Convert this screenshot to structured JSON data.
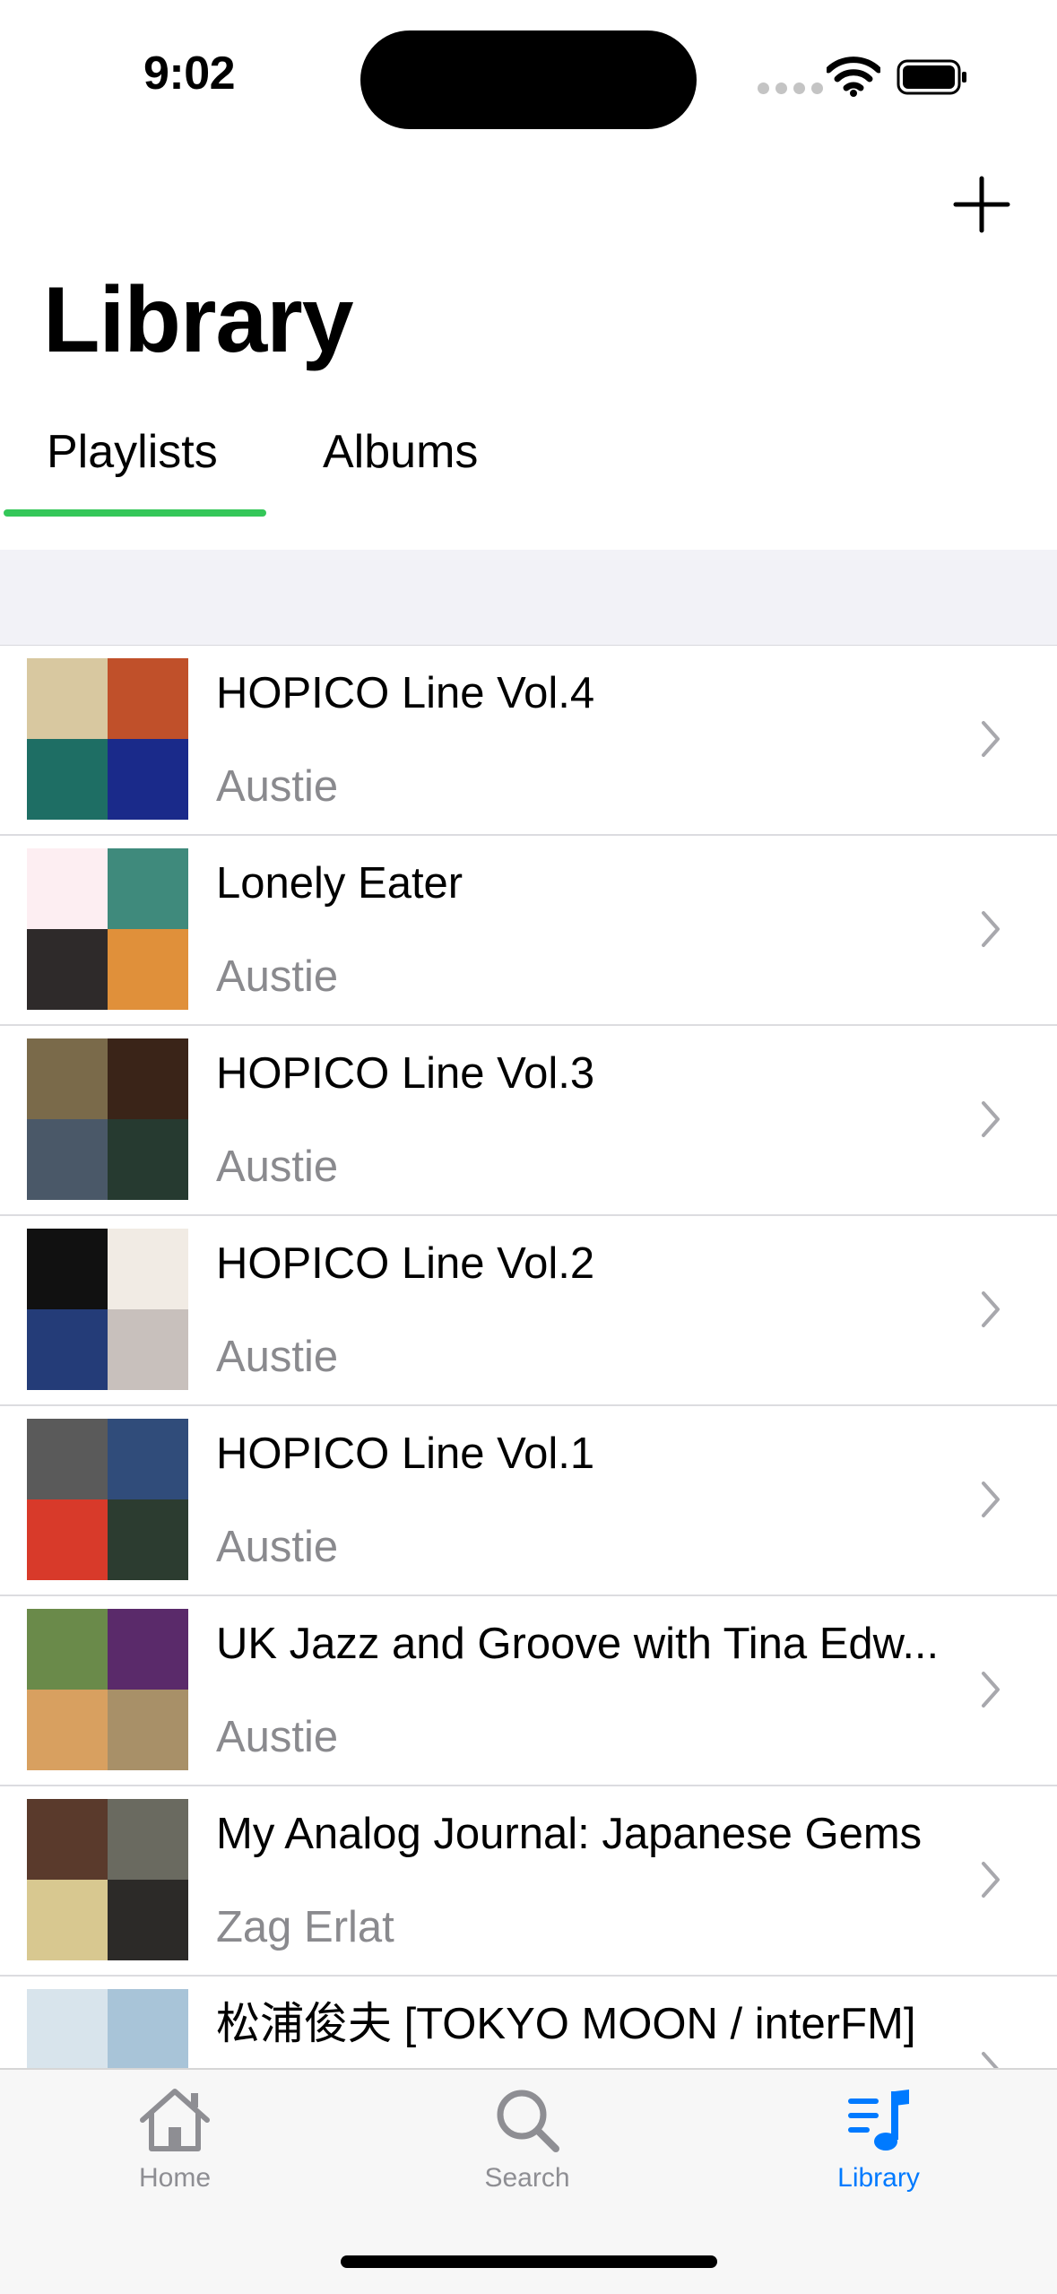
{
  "status_bar": {
    "time": "9:02"
  },
  "header": {
    "title": "Library",
    "add_icon": "plus-icon"
  },
  "tabs": [
    {
      "label": "Playlists",
      "selected": true
    },
    {
      "label": "Albums",
      "selected": false
    }
  ],
  "accent_color": "#34c759",
  "active_tab_color": "#007aff",
  "playlists": [
    {
      "title": "HOPICO Line Vol.4",
      "owner": "Austie",
      "art_colors": [
        "#d8c8a0",
        "#c0502a",
        "#1e6e64",
        "#1a2a8a"
      ]
    },
    {
      "title": "Lonely Eater",
      "owner": "Austie",
      "art_colors": [
        "#fdeef2",
        "#3f8a7c",
        "#2e2a2a",
        "#e0903a"
      ]
    },
    {
      "title": "HOPICO Line Vol.3",
      "owner": "Austie",
      "art_colors": [
        "#7a6a4a",
        "#3a2418",
        "#4a5868",
        "#263a30"
      ]
    },
    {
      "title": "HOPICO Line Vol.2",
      "owner": "Austie",
      "art_colors": [
        "#111111",
        "#f1ebe4",
        "#243c78",
        "#c8c0bc"
      ]
    },
    {
      "title": "HOPICO Line Vol.1",
      "owner": "Austie",
      "art_colors": [
        "#5a5a5a",
        "#304c7a",
        "#d83a2a",
        "#2c3c30"
      ]
    },
    {
      "title": "UK Jazz and Groove with Tina Edw...",
      "owner": "Austie",
      "art_colors": [
        "#6a8a4a",
        "#5a2a6a",
        "#d8a060",
        "#a89068"
      ]
    },
    {
      "title": "My Analog Journal: Japanese Gems",
      "owner": "Zag Erlat",
      "art_colors": [
        "#5a3a2c",
        "#6a6a60",
        "#d8c890",
        "#2c2a28"
      ]
    },
    {
      "title": "松浦俊夫 [TOKYO MOON / interFM]",
      "owner": "",
      "art_colors": [
        "#d8e4ec",
        "#a8c4d8",
        "#5a5a60",
        "#b8ccd8"
      ]
    }
  ],
  "tab_bar": [
    {
      "label": "Home",
      "icon": "home-icon"
    },
    {
      "label": "Search",
      "icon": "search-icon"
    },
    {
      "label": "Library",
      "icon": "music-library-icon",
      "active": true
    }
  ]
}
